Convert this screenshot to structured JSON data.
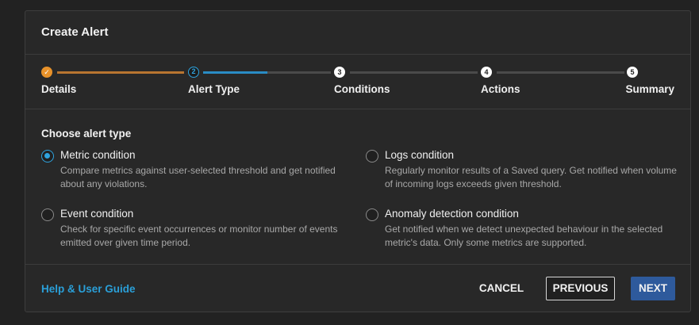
{
  "dialog": {
    "title": "Create Alert"
  },
  "stepper": {
    "steps": [
      {
        "number": "1",
        "label": "Details",
        "state": "done",
        "icon": "check-icon"
      },
      {
        "number": "2",
        "label": "Alert Type",
        "state": "active"
      },
      {
        "number": "3",
        "label": "Conditions",
        "state": "pending"
      },
      {
        "number": "4",
        "label": "Actions",
        "state": "pending"
      },
      {
        "number": "5",
        "label": "Summary",
        "state": "pending"
      }
    ],
    "check_glyph": "✓",
    "active_progress": 0.5,
    "colors": {
      "done": "#e8922a",
      "active": "#2fa3de",
      "pending_track": "#4a4a4a"
    }
  },
  "body": {
    "title": "Choose alert type",
    "options": [
      {
        "label": "Metric condition",
        "description": "Compare metrics against user-selected threshold and get notified about any violations.",
        "selected": true
      },
      {
        "label": "Logs condition",
        "description": "Regularly monitor results of a Saved query. Get notified when volume of incoming logs exceeds given threshold.",
        "selected": false
      },
      {
        "label": "Event condition",
        "description": "Check for specific event occurrences or monitor number of events emitted over given time period.",
        "selected": false
      },
      {
        "label": "Anomaly detection condition",
        "description": "Get notified when we detect unexpected behaviour in the selected metric's data. Only some metrics are supported.",
        "selected": false
      }
    ]
  },
  "footer": {
    "help_label": "Help & User Guide",
    "cancel_label": "CANCEL",
    "previous_label": "PREVIOUS",
    "next_label": "NEXT"
  }
}
